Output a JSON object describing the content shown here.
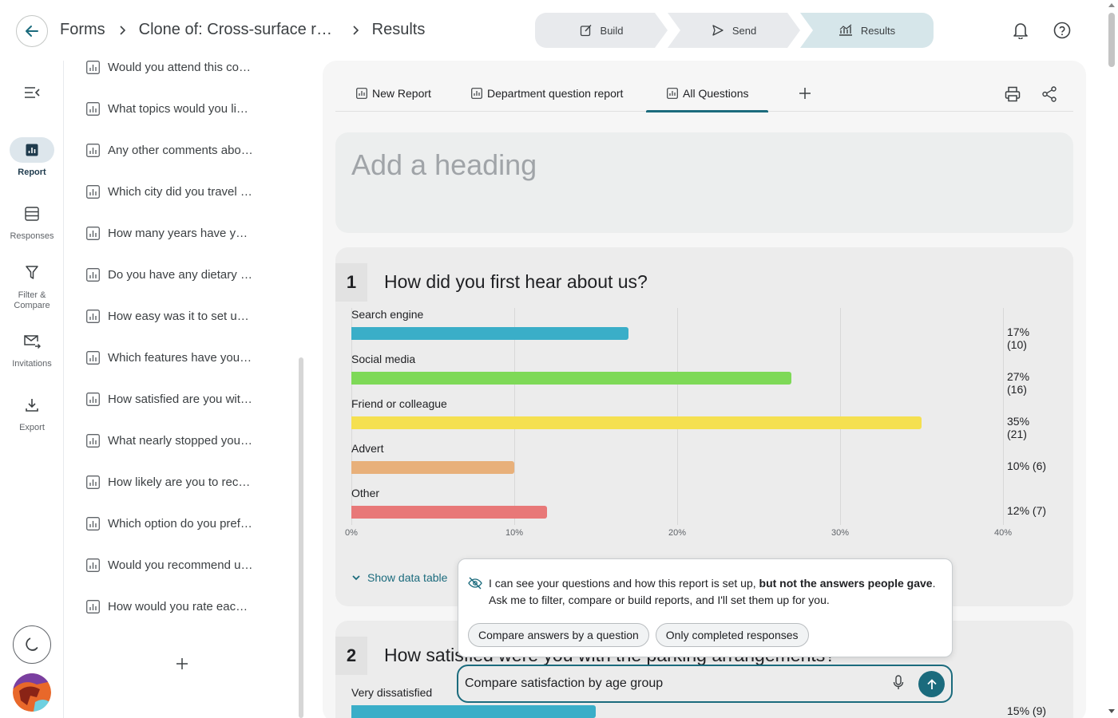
{
  "breadcrumb": {
    "root": "Forms",
    "form": "Clone of: Cross-surface regression",
    "current": "Results"
  },
  "steps": [
    {
      "label": "Build",
      "icon": "edit-icon"
    },
    {
      "label": "Send",
      "icon": "send-icon"
    },
    {
      "label": "Results",
      "icon": "results-chart-icon",
      "active": true
    }
  ],
  "rail": {
    "items": [
      {
        "label": "Report",
        "icon": "report-icon",
        "active": true
      },
      {
        "label": "Responses",
        "icon": "responses-icon"
      },
      {
        "label": "Filter &\nCompare",
        "icon": "filter-icon"
      },
      {
        "label": "Invitations",
        "icon": "invitations-icon"
      },
      {
        "label": "Export",
        "icon": "export-icon"
      }
    ]
  },
  "questions": [
    "Would you attend this co…",
    "What topics would you lik…",
    "Any other comments abo…",
    "Which city did you travel f…",
    "How many years have yo…",
    "Do you have any dietary r…",
    "How easy was it to set up…",
    "Which features have you …",
    "How satisfied are you wit…",
    "What nearly stopped you …",
    "How likely are you to reco…",
    "Which option do you pref…",
    "Would you recommend u…",
    "How would you rate each…"
  ],
  "tabs": [
    {
      "label": "New Report"
    },
    {
      "label": "Department question report"
    },
    {
      "label": "All Questions",
      "active": true
    }
  ],
  "heading_placeholder": "Add a heading",
  "q1": {
    "number": "1",
    "title": "How did you first hear about us?",
    "show_table": "Show data table"
  },
  "q2": {
    "number": "2",
    "title": "How satisfied were you with the parking arrangements?",
    "first_category": "Very dissatisfied",
    "first_value_label": "15% (9)",
    "first_value": 15
  },
  "chart_data": {
    "type": "bar",
    "orientation": "horizontal",
    "title": "How did you first hear about us?",
    "categories": [
      "Search engine",
      "Social media",
      "Friend or colleague",
      "Advert",
      "Other"
    ],
    "values": [
      17,
      27,
      35,
      10,
      12
    ],
    "counts": [
      10,
      16,
      21,
      6,
      7
    ],
    "value_labels": [
      "17% (10)",
      "27% (16)",
      "35% (21)",
      "10% (6)",
      "12% (7)"
    ],
    "colors": [
      "#3aaec8",
      "#7ed957",
      "#f5e050",
      "#e8b07a",
      "#e87878"
    ],
    "xlim": [
      0,
      40
    ],
    "xticks": [
      "0%",
      "10%",
      "20%",
      "30%",
      "40%"
    ],
    "grid": true
  },
  "chat": {
    "message_plain": "I can see your questions and how this report is set up, ",
    "message_bold": "but not the answers people gave",
    "message_end": ".",
    "message_line2": "Ask me to filter, compare or build reports, and I'll set them up for you.",
    "chips": [
      "Compare answers by a question",
      "Only completed responses"
    ],
    "input_value": "Compare satisfaction by age group"
  },
  "colors": {
    "accent": "#1b6b7d",
    "active_step": "#d6e6ea"
  }
}
